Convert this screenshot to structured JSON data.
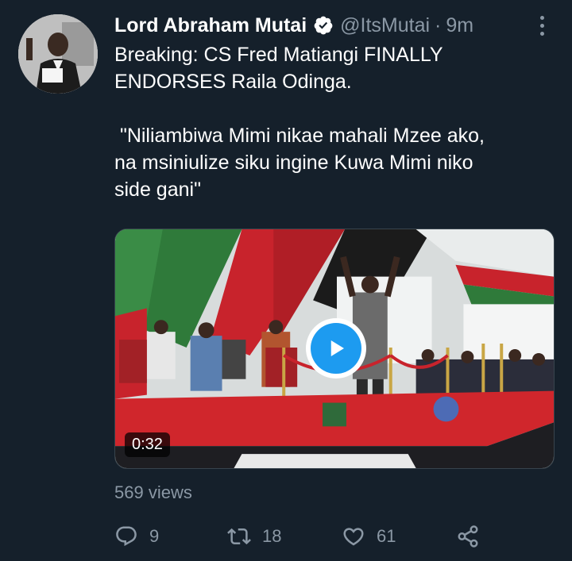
{
  "tweet": {
    "author": {
      "display_name": "Lord Abraham Mutai",
      "handle": "@ItsMutai",
      "verified": true
    },
    "separator": "·",
    "timestamp": "9m",
    "text_lines": [
      "Breaking: CS Fred Matiangi FINALLY",
      "ENDORSES Raila Odinga.",
      "",
      " \"Niliambiwa Mimi nikae mahali Mzee ako,",
      "na msiniulize siku ingine Kuwa Mimi niko",
      "side gani\""
    ],
    "media": {
      "type": "video",
      "duration": "0:32"
    },
    "views": "569 views",
    "actions": {
      "reply_count": "9",
      "retweet_count": "18",
      "like_count": "61"
    }
  },
  "colors": {
    "background": "#15202b",
    "primary_text": "#ffffff",
    "secondary_text": "#8b98a5",
    "accent": "#1d9bf0"
  }
}
